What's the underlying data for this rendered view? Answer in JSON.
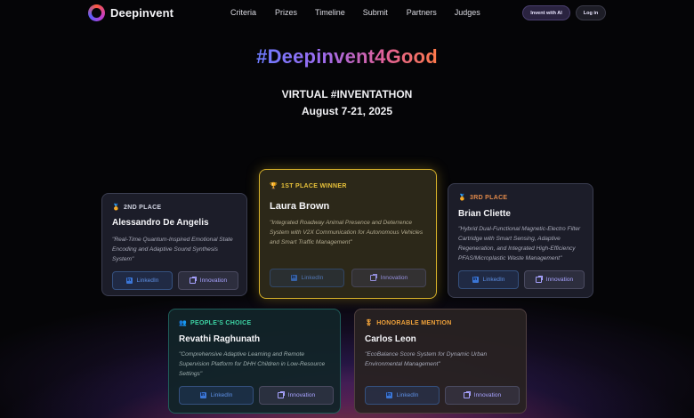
{
  "brand": {
    "name": "Deepinvent"
  },
  "nav": {
    "links": [
      "Criteria",
      "Prizes",
      "Timeline",
      "Submit",
      "Partners",
      "Judges"
    ],
    "invent_ai_label": "Invent with AI",
    "login_label": "Log in"
  },
  "hero": {
    "title": "#Deepinvent4Good",
    "subtitle": "VIRTUAL #INVENTATHON",
    "dates": "August 7-21, 2025"
  },
  "colors": {
    "gold": "#d8b22a",
    "silver_badge": "#cfd2e0",
    "bronze_badge": "#e0894a",
    "peoples_choice": "#3ed7a6",
    "honorable": "#f0a23a",
    "linkedin": "#5d8fe4",
    "innovation": "#a7a2ff"
  },
  "winners": [
    {
      "badge": "2ND PLACE",
      "badge_icon": "medal-icon",
      "name": "Alessandro De Angelis",
      "description": "\"Real-Time Quantum-Inspired Emotional State Encoding and Adaptive Sound Synthesis System\"",
      "linkedin_label": "LinkedIn",
      "innovation_label": "Innovation"
    },
    {
      "badge": "1ST PLACE WINNER",
      "badge_icon": "trophy-icon",
      "name": "Laura Brown",
      "description": "\"Integrated Roadway Animal Presence and Deterrence System with V2X Communication for Autonomous Vehicles and Smart Traffic Management\"",
      "linkedin_label": "LinkedIn",
      "innovation_label": "Innovation"
    },
    {
      "badge": "3RD PLACE",
      "badge_icon": "medal-icon",
      "name": "Brian Cliette",
      "description": "\"Hybrid Dual-Functional Magnetic-Electro Filter Cartridge with Smart Sensing, Adaptive Regeneration, and Integrated High-Efficiency PFAS/Microplastic Waste Management\"",
      "linkedin_label": "LinkedIn",
      "innovation_label": "Innovation"
    },
    {
      "badge": "PEOPLE'S CHOICE",
      "badge_icon": "people-icon",
      "name": "Revathi Raghunath",
      "description": "\"Comprehensive Adaptive Learning and Remote Supervision Platform for DHH Children in Low-Resource Settings\"",
      "linkedin_label": "LinkedIn",
      "innovation_label": "Innovation"
    },
    {
      "badge": "HONORABLE MENTION",
      "badge_icon": "medal-icon",
      "name": "Carlos Leon",
      "description": "\"EcoBalance Score System for Dynamic Urban Environmental Management\"",
      "linkedin_label": "LinkedIn",
      "innovation_label": "Innovation"
    }
  ]
}
